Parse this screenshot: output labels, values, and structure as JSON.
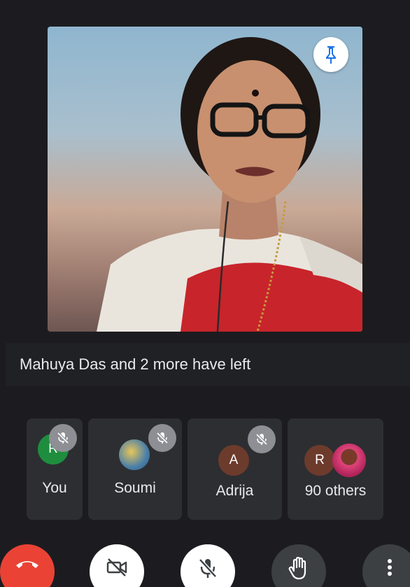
{
  "notice": {
    "text": "Mahuya Das and 2 more have left"
  },
  "participants": [
    {
      "label": "You",
      "avatar_initial": "R",
      "avatar_color": "#1e8e3e",
      "muted": true
    },
    {
      "label": "Soumi",
      "avatar_initial": "",
      "avatar_type": "photo",
      "muted": true
    },
    {
      "label": "Adrija",
      "avatar_initial": "A",
      "avatar_color": "#6d3b2c",
      "muted": true
    },
    {
      "label": "90 others",
      "avatar_initial": "R",
      "avatar_color": "#6d3b2c",
      "extra_avatar": "photo"
    }
  ],
  "controls": {
    "end_call": {
      "icon": "phone-hangup-icon",
      "color": "#ea4335"
    },
    "camera": {
      "icon": "video-off-icon"
    },
    "mic": {
      "icon": "mic-off-icon"
    },
    "raise_hand": {
      "icon": "hand-icon"
    },
    "more": {
      "icon": "more-vert-icon"
    }
  },
  "main_tile": {
    "pin_icon": "pin-icon"
  }
}
